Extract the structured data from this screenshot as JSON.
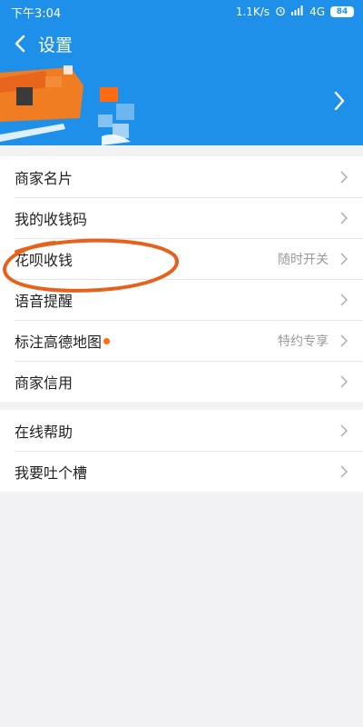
{
  "status_bar": {
    "time": "下午3:04",
    "speed": "1.1K/s",
    "network": "4G",
    "battery": "84"
  },
  "nav": {
    "title": "设置"
  },
  "menu_group1": [
    {
      "label": "商家名片",
      "value": ""
    },
    {
      "label": "我的收钱码",
      "value": ""
    },
    {
      "label": "花呗收钱",
      "value": "随时开关"
    },
    {
      "label": "语音提醒",
      "value": ""
    },
    {
      "label": "标注高德地图",
      "value": "特约专享",
      "has_dot": true
    },
    {
      "label": "商家信用",
      "value": ""
    }
  ],
  "menu_group2": [
    {
      "label": "在线帮助",
      "value": ""
    },
    {
      "label": "我要吐个槽",
      "value": ""
    }
  ],
  "colors": {
    "header_blue": "#1e90ea",
    "accent_orange": "#ff6a13",
    "annotation": "#e8611a"
  }
}
